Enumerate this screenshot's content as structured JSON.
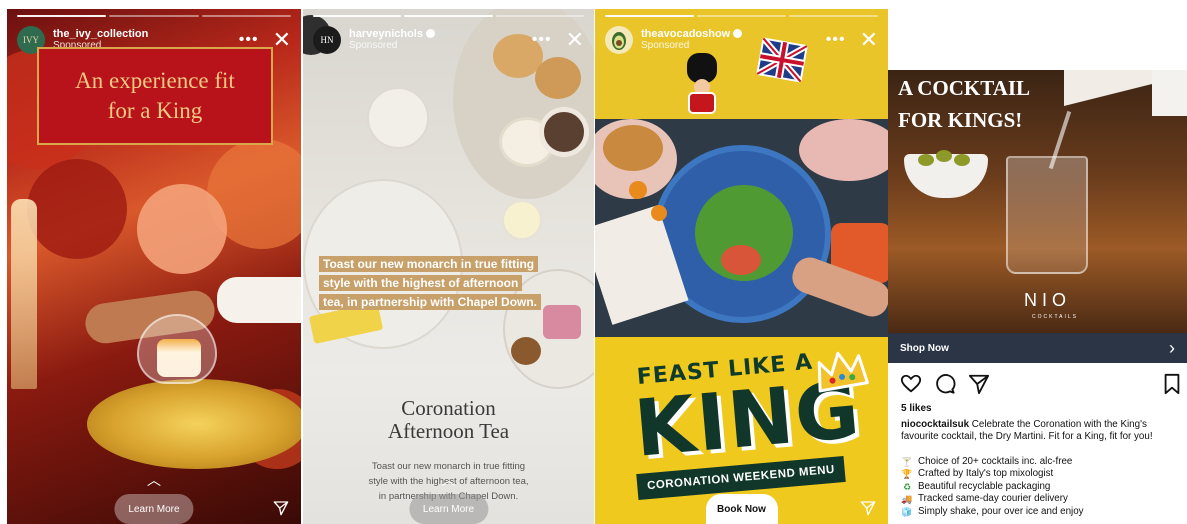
{
  "story1": {
    "username": "the_ivy_collection",
    "sponsored": "Sponsored",
    "avatar_text": "IVY",
    "banner_line1": "An experience fit",
    "banner_line2": "for a King",
    "learn_more": "Learn More"
  },
  "story2": {
    "username": "harveynichols",
    "sponsored": "Sponsored",
    "avatar_text": "HN",
    "caption_line1": "Toast our new monarch in true fitting",
    "caption_line2": "style with the highest of afternoon",
    "caption_line3": "tea, in partnership with Chapel Down.",
    "title_line1": "Coronation",
    "title_line2": "Afternoon Tea",
    "body_line1": "Toast our new monarch in true fitting",
    "body_line2": "style with the highest of afternoon tea,",
    "body_line3": "in partnership with Chapel Down.",
    "learn_more": "Learn More"
  },
  "story3": {
    "username": "theavocadoshow",
    "sponsored": "Sponsored",
    "feast": "FEAST LIKE A",
    "king": "KING",
    "menu": "CORONATION WEEKEND MENU",
    "book_now": "Book Now"
  },
  "post": {
    "headline1": "A COCKTAIL",
    "headline2": "FOR KINGS!",
    "brand": "NIO",
    "brand_sub": "COCKTAILS",
    "shop_now": "Shop Now",
    "likes": "5 likes",
    "caption_user": "niococktailsuk",
    "caption_text": "Celebrate the Coronation with the King's favourite cocktail, the Dry Martini. Fit for a King, fit for you!",
    "list": [
      {
        "icon": "🍸",
        "icon_name": "cocktail-glass-icon",
        "text": "Choice of 20+ cocktails inc. alc-free"
      },
      {
        "icon": "🏆",
        "icon_name": "trophy-icon",
        "text": "Crafted by Italy's top mixologist"
      },
      {
        "icon": "♻",
        "icon_name": "recycle-icon",
        "text": "Beautiful recyclable packaging"
      },
      {
        "icon": "🚚",
        "icon_name": "delivery-truck-icon",
        "text": "Tracked same-day courier delivery"
      },
      {
        "icon": "🧊",
        "icon_name": "ice-icon",
        "text": "Simply shake, pour over ice and enjoy"
      }
    ]
  },
  "colors": {
    "ivy_red": "#b8121b",
    "ivy_gold": "#f1c983",
    "hn_caption_bg": "#c7a06a",
    "avocado_yellow": "#f0c91f",
    "avocado_green": "#10372a",
    "nio_navy": "#2c3546"
  }
}
